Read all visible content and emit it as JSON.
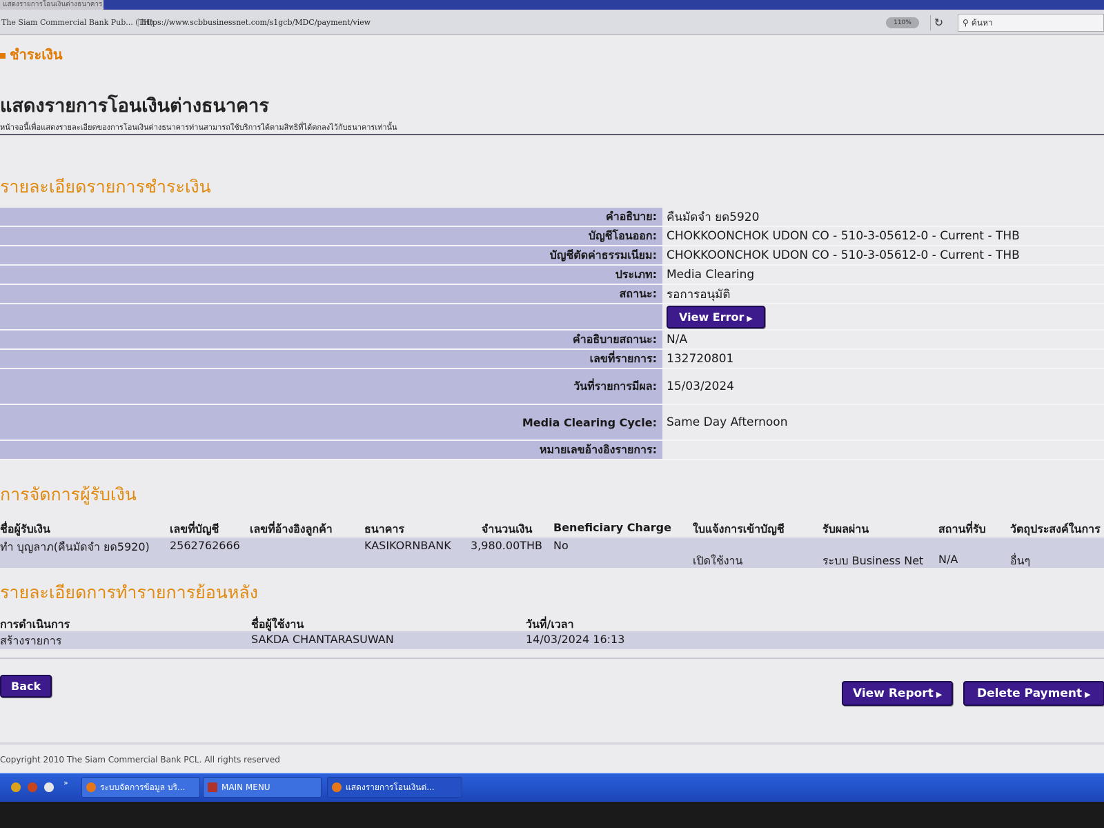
{
  "browser": {
    "site_identity": "The Siam Commercial Bank Pub... (TH)",
    "url": "https://www.scbbusinessnet.com/s1gcb/MDC/payment/view",
    "zoom": "110%",
    "search_placeholder": "ค้นหา"
  },
  "page": {
    "section_label": "ชำระเงิน",
    "title": "แสดงรายการโอนเงินต่างธนาคาร",
    "subtitle": "หน้าจอนี้เพื่อแสดงรายละเอียดของการโอนเงินต่างธนาคารท่านสามารถใช้บริการได้ตามสิทธิที่ได้ตกลงไว้กับธนาคารเท่านั้น"
  },
  "details": {
    "heading": "รายละเอียดรายการชำระเงิน",
    "rows": {
      "description": {
        "label": "คำอธิบาย:",
        "value": "คืนมัดจำ ยด5920"
      },
      "debit_account": {
        "label": "บัญชีโอนออก:",
        "value": "CHOKKOONCHOK UDON CO - 510-3-05612-0 - Current - THB"
      },
      "fee_account": {
        "label": "บัญชีตัดค่าธรรมเนียม:",
        "value": "CHOKKOONCHOK UDON CO - 510-3-05612-0 - Current - THB"
      },
      "type": {
        "label": "ประเภท:",
        "value": "Media Clearing"
      },
      "status": {
        "label": "สถานะ:",
        "value": "รอการอนุมัติ"
      },
      "status_description": {
        "label": "คำอธิบายสถานะ:",
        "value": "N/A"
      },
      "transaction_no": {
        "label": "เลขที่รายการ:",
        "value": "132720801"
      },
      "effective_date": {
        "label": "วันที่รายการมีผล:",
        "value": "15/03/2024"
      },
      "clearing_cycle": {
        "label": "Media Clearing Cycle:",
        "value": "Same Day Afternoon"
      },
      "reference_no": {
        "label": "หมายเลขอ้างอิงรายการ:",
        "value": ""
      }
    },
    "view_error_label": "View Error"
  },
  "payees": {
    "heading": "การจัดการผู้รับเงิน",
    "columns": {
      "payee": "ชื่อผู้รับเงิน",
      "account_no": "เลขที่บัญชี",
      "customer_ref": "เลขที่อ้างอิงลูกค้า",
      "bank": "ธนาคาร",
      "amount": "จำนวนเงิน",
      "beneficiary_charge": "Beneficiary Charge",
      "credit_advice": "ใบแจ้งการเข้าบัญชี",
      "receive_via": "รับผลผ่าน",
      "receive_location": "สถานที่รับ",
      "purpose": "วัตถุประสงค์ในการ"
    },
    "rows": [
      {
        "payee": "ทำ บุญลาภ(คืนมัดจำ ยด5920)",
        "account_no": "2562762666",
        "customer_ref": "",
        "bank": "KASIKORNBANK",
        "amount": "3,980.00THB",
        "beneficiary_charge": "No",
        "credit_advice": "เปิดใช้งาน",
        "receive_via": "ระบบ Business Net",
        "receive_location": "N/A",
        "purpose": "อื่นๆ"
      }
    ]
  },
  "history": {
    "heading": "รายละเอียดการทำรายการย้อนหลัง",
    "columns": {
      "action": "การดำเนินการ",
      "user": "ชื่อผู้ใช้งาน",
      "datetime": "วันที่/เวลา"
    },
    "rows": [
      {
        "action": "สร้างรายการ",
        "user": "SAKDA CHANTARASUWAN",
        "datetime": "14/03/2024 16:13"
      }
    ]
  },
  "actions": {
    "back": "Back",
    "view_report": "View Report",
    "delete_payment": "Delete Payment"
  },
  "footer": {
    "copyright": "Copyright 2010 The Siam Commercial Bank PCL. All rights reserved"
  },
  "taskbar": {
    "tasks": [
      "ระบบจัดการข้อมูล บริ...",
      "MAIN MENU",
      "แสดงรายการโอนเงินต่..."
    ]
  }
}
